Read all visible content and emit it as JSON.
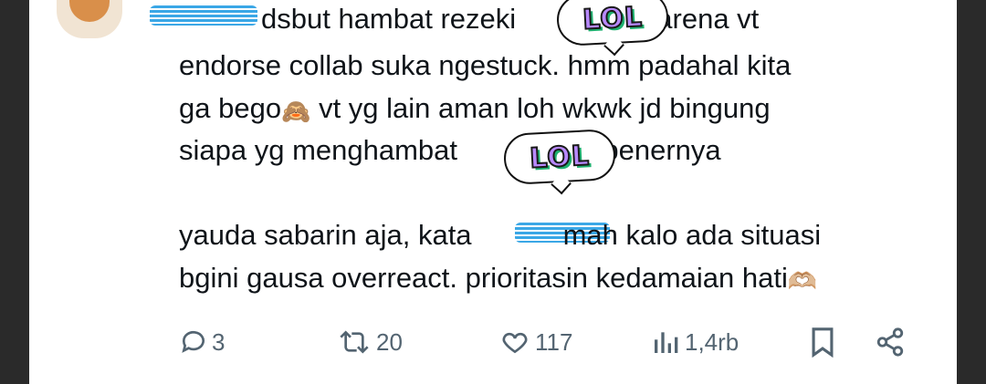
{
  "tweet": {
    "line1_part1": "dsbut hambat rezeki",
    "line1_part2": "karena vt",
    "line2": "endorse collab suka ngestuck. hmm padahal kita",
    "line3_part1": "ga bego",
    "line3_emoji": "🙈",
    "line3_part2": "vt yg lain aman loh wkwk jd bingung",
    "line4_part1": "siapa yg menghambat",
    "line4_part2": "sebenernya",
    "line5_part1": "yauda sabarin aja, kata",
    "line5_part2": "mah kalo ada situasi",
    "line6": "bgini gausa overreact. prioritasin kedamaian hati",
    "line6_emoji": "🫶🏼"
  },
  "stickers": {
    "sticker1": "LOL",
    "sticker2": "LOL"
  },
  "actions": {
    "replies": "3",
    "reposts": "20",
    "likes": "117",
    "views": "1,4rb"
  },
  "colors": {
    "text": "#0f1419",
    "icon": "#536471",
    "sticker_fill": "#b889ff",
    "sticker_shadow": "#1fb06f",
    "scribble": "#3aa7e6"
  }
}
